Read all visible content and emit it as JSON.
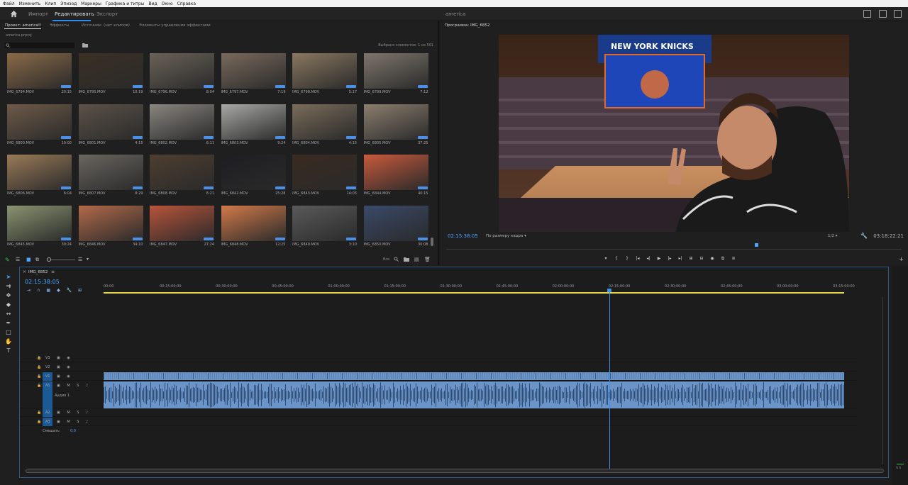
{
  "menu": [
    "Файл",
    "Изменить",
    "Клип",
    "Эпизод",
    "Маркеры",
    "Графика и титры",
    "Вид",
    "Окно",
    "Справка"
  ],
  "workspace": {
    "tabs": [
      {
        "label": "Импорт",
        "active": false
      },
      {
        "label": "Редактировать",
        "active": true
      },
      {
        "label": "Экспорт",
        "active": false
      }
    ],
    "sequence_title": "america"
  },
  "project": {
    "tabs": [
      "Проект: america",
      "Эффекты",
      "Источник: (нет клипов)",
      "Элементы управления эффектами"
    ],
    "file": "america.prproj",
    "selected_count": "Выбрано элементов: 1 из 501",
    "clips": [
      {
        "name": "IMG_6794.MOV",
        "duration": "20:15",
        "color": "#8a6a48"
      },
      {
        "name": "IMG_6795.MOV",
        "duration": "10:19",
        "color": "#3b3024"
      },
      {
        "name": "IMG_6796.MOV",
        "duration": "8:04",
        "color": "#6a6258"
      },
      {
        "name": "IMG_6797.MOV",
        "duration": "7:19",
        "color": "#7a6a5c"
      },
      {
        "name": "IMG_6798.MOV",
        "duration": "5:17",
        "color": "#8a7860"
      },
      {
        "name": "IMG_6799.MOV",
        "duration": "7:12",
        "color": "#7e766c"
      },
      {
        "name": "IMG_6800.MOV",
        "duration": "19:00",
        "color": "#6e5a48"
      },
      {
        "name": "IMG_6801.MOV",
        "duration": "4:15",
        "color": "#5c5248"
      },
      {
        "name": "IMG_6802.MOV",
        "duration": "6:11",
        "color": "#8a8680"
      },
      {
        "name": "IMG_6803.MOV",
        "duration": "9:24",
        "color": "#a8a8a6"
      },
      {
        "name": "IMG_6804.MOV",
        "duration": "4:15",
        "color": "#7a6c5a"
      },
      {
        "name": "IMG_6805.MOV",
        "duration": "37:25",
        "color": "#8c7e6e"
      },
      {
        "name": "IMG_6806.MOV",
        "duration": "6:04",
        "color": "#9a7a58"
      },
      {
        "name": "IMG_6807.MOV",
        "duration": "8:29",
        "color": "#6a6660"
      },
      {
        "name": "IMG_6808.MOV",
        "duration": "6:21",
        "color": "#4e3e30"
      },
      {
        "name": "IMG_6842.MOV",
        "duration": "25:28",
        "color": "#1e1e22"
      },
      {
        "name": "IMG_6843.MOV",
        "duration": "14:03",
        "color": "#3a2a20"
      },
      {
        "name": "IMG_6844.MOV",
        "duration": "40:15",
        "color": "#c85a3c"
      },
      {
        "name": "IMG_6845.MOV",
        "duration": "39:24",
        "color": "#8a9470"
      },
      {
        "name": "IMG_6846.MOV",
        "duration": "34:10",
        "color": "#b26a4a"
      },
      {
        "name": "IMG_6847.MOV",
        "duration": "27:24",
        "color": "#b8543a"
      },
      {
        "name": "IMG_6848.MOV",
        "duration": "12:25",
        "color": "#d27a4a"
      },
      {
        "name": "IMG_6849.MOV",
        "duration": "3:10",
        "color": "#5a5a5a"
      },
      {
        "name": "IMG_6850.MOV",
        "duration": "30:08",
        "color": "#3a4a6a"
      }
    ],
    "filter_label": "Все"
  },
  "program": {
    "label": "Программа: IMG_6852",
    "timecode": "02:15:38:05",
    "fit": "По размеру кадра",
    "resolution": "1/2",
    "duration": "03:18:22:21",
    "frame_text": "NEW YORK KNICKS",
    "transport": [
      "▾",
      "{",
      "}",
      "|◂",
      "◂|",
      "▶",
      "|▸",
      "▸|",
      "⊞",
      "⊟",
      "◉",
      "⧉",
      "⧈"
    ]
  },
  "timeline": {
    "tab": "IMG_6852",
    "timecode": "02:15:38:05",
    "ticks": [
      "00:00",
      "00:15:00:00",
      "00:30:00:00",
      "00:45:00:00",
      "01:00:00:00",
      "01:15:00:00",
      "01:30:00:00",
      "01:45:00:00",
      "02:00:00:00",
      "02:15:00:00",
      "02:30:00:00",
      "02:45:00:00",
      "03:00:00:00",
      "03:15:00:00"
    ],
    "tracks": [
      {
        "id": "V3",
        "kind": "video",
        "buttons": "▣ ◉"
      },
      {
        "id": "V2",
        "kind": "video",
        "buttons": "▣ ◉"
      },
      {
        "id": "V1",
        "kind": "video",
        "buttons": "▣ ◉"
      },
      {
        "id": "A1",
        "kind": "audio",
        "buttons": "▣ M S ♪",
        "name": "Аудио 1"
      },
      {
        "id": "A2",
        "kind": "audio",
        "buttons": "▣ M S ♪"
      },
      {
        "id": "A3",
        "kind": "audio",
        "buttons": "▣ M S ♪"
      }
    ],
    "mix_label": "Смешать",
    "mix_value": "0,0"
  },
  "meter_label": "S S"
}
